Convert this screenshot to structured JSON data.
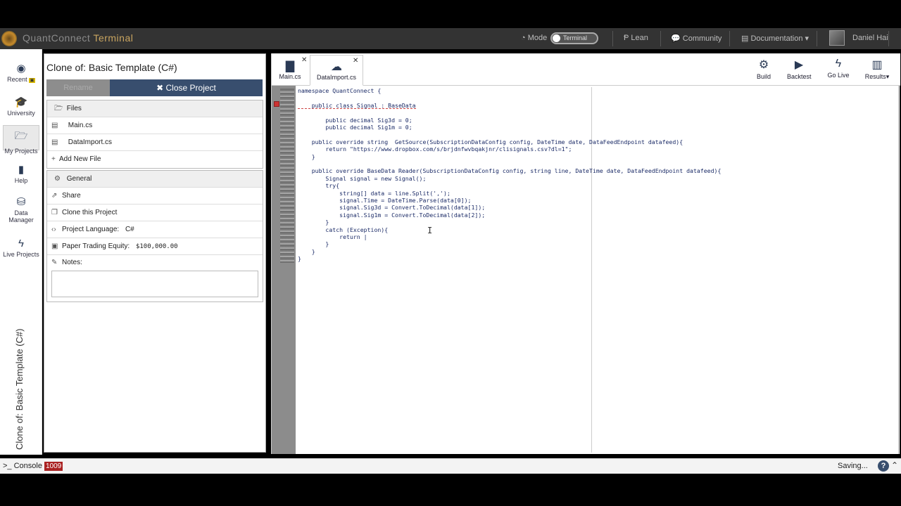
{
  "nav": {
    "brand_main": "QuantConnect",
    "brand_sub": "Terminal",
    "mode_label": "Mode",
    "mode_value": "Terminal",
    "lean": "Lean",
    "community": "Community",
    "documentation": "Documentation",
    "user": "Daniel Hai"
  },
  "sidebar": {
    "items": [
      {
        "label": "Recent",
        "icon": "rss-icon"
      },
      {
        "label": "University",
        "icon": "graduation-cap-icon"
      },
      {
        "label": "My Projects",
        "icon": "folder-open-icon"
      },
      {
        "label": "Help",
        "icon": "book-icon"
      },
      {
        "label": "Data Manager",
        "icon": "database-icon"
      },
      {
        "label": "Live Projects",
        "icon": "bolt-icon"
      }
    ],
    "vertical_title": "Clone of: Basic Template (C#)"
  },
  "project": {
    "title": "Clone of: Basic Template (C#)",
    "disabled_button": "Rename",
    "close_button": "✖ Close Project",
    "files_header": "Files",
    "files": [
      "Main.cs",
      "DataImport.cs"
    ],
    "add_file": "Add New File",
    "general_header": "General",
    "share": "Share",
    "clone": "Clone this Project",
    "language_label": "Project Language:",
    "language_value": "C#",
    "equity_label": "Paper Trading Equity:",
    "equity_value": "$100,000.00",
    "notes_label": "Notes:"
  },
  "editor": {
    "tabs": [
      {
        "label": "Main.cs",
        "icon": "file-icon"
      },
      {
        "label": "DataImport.cs",
        "icon": "cloud-upload-icon"
      }
    ],
    "toolbar": [
      {
        "label": "Build",
        "icon": "gears-icon"
      },
      {
        "label": "Backtest",
        "icon": "play-icon"
      },
      {
        "label": "Go Live",
        "icon": "bolt-icon"
      },
      {
        "label": "Results",
        "icon": "bar-chart-icon"
      }
    ],
    "code_lines": [
      "namespace QuantConnect {",
      "",
      "    public class Signal : BaseData",
      "",
      "        public decimal Sig3d = 0;",
      "        public decimal Sig1m = 0;",
      "",
      "    public override string  GetSource(SubscriptionDataConfig config, DateTime date, DataFeedEndpoint datafeed){",
      "        return \"https://www.dropbox.com/s/brjdnfwvbqakjnr/clisignals.csv?dl=1\";",
      "    }",
      "",
      "    public override BaseData Reader(SubscriptionDataConfig config, string line, DateTime date, DataFeedEndpoint datafeed){",
      "        Signal signal = new Signal();",
      "        try{",
      "            string[] data = line.Split(',');",
      "            signal.Time = DateTime.Parse(data[0]);",
      "            signal.Sig3d = Convert.ToDecimal(data[1]);",
      "            signal.Sig1m = Convert.ToDecimal(data[2]);",
      "        }",
      "        catch (Exception){",
      "            return |",
      "        }",
      "    }",
      "}"
    ]
  },
  "status": {
    "console": "Console",
    "console_count": "1009",
    "saving": "Saving..."
  }
}
